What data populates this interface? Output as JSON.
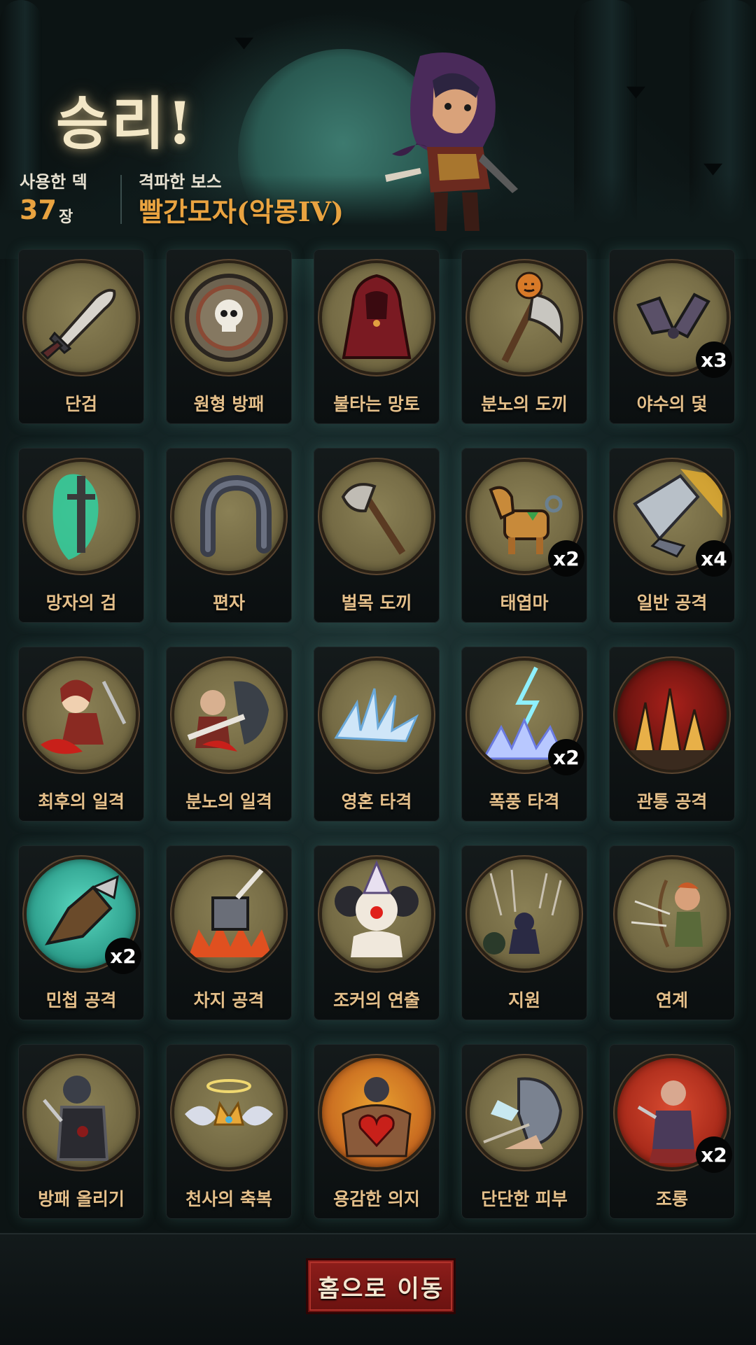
{
  "header": {
    "title": "승리!",
    "deck_label": "사용한 덱",
    "deck_count": "37",
    "deck_unit": "장",
    "boss_label": "격파한 보스",
    "boss_name": "빨간모자(악몽IV)"
  },
  "cards": [
    {
      "name": "단검",
      "icon": "dagger-icon",
      "count": ""
    },
    {
      "name": "원형 방패",
      "icon": "round-shield-icon",
      "count": ""
    },
    {
      "name": "불타는 망토",
      "icon": "red-cloak-icon",
      "count": ""
    },
    {
      "name": "분노의 도끼",
      "icon": "pumpkin-axe-icon",
      "count": ""
    },
    {
      "name": "야수의 덫",
      "icon": "beast-trap-icon",
      "count": "x3"
    },
    {
      "name": "망자의 검",
      "icon": "ghost-sword-icon",
      "count": ""
    },
    {
      "name": "편자",
      "icon": "horseshoe-icon",
      "count": ""
    },
    {
      "name": "벌목 도끼",
      "icon": "hatchet-icon",
      "count": ""
    },
    {
      "name": "태엽마",
      "icon": "wind-up-horse-icon",
      "count": "x2"
    },
    {
      "name": "일반 공격",
      "icon": "sword-strike-icon",
      "count": "x4"
    },
    {
      "name": "최후의 일격",
      "icon": "final-strike-icon",
      "count": ""
    },
    {
      "name": "분노의 일격",
      "icon": "rage-strike-icon",
      "count": ""
    },
    {
      "name": "영혼 타격",
      "icon": "ice-spikes-icon",
      "count": ""
    },
    {
      "name": "폭풍 타격",
      "icon": "lightning-icon",
      "count": "x2"
    },
    {
      "name": "관통 공격",
      "icon": "pierce-spikes-icon",
      "count": ""
    },
    {
      "name": "민첩 공격",
      "icon": "swift-slash-icon",
      "count": "x2"
    },
    {
      "name": "차지 공격",
      "icon": "hammer-slam-icon",
      "count": ""
    },
    {
      "name": "조커의 연출",
      "icon": "joker-icon",
      "count": ""
    },
    {
      "name": "지원",
      "icon": "arrow-rain-icon",
      "count": ""
    },
    {
      "name": "연계",
      "icon": "archer-icon",
      "count": ""
    },
    {
      "name": "방패 올리기",
      "icon": "tower-shield-icon",
      "count": ""
    },
    {
      "name": "천사의 축복",
      "icon": "angel-crown-icon",
      "count": ""
    },
    {
      "name": "용감한 의지",
      "icon": "brave-heart-icon",
      "count": ""
    },
    {
      "name": "단단한 피부",
      "icon": "stone-skin-icon",
      "count": ""
    },
    {
      "name": "조롱",
      "icon": "taunt-icon",
      "count": "x2"
    }
  ],
  "footer": {
    "home_button": "홈으로 이동"
  },
  "colors": {
    "accent": "#e9a340",
    "card_label": "#e4bf8a",
    "emblem_bg": "#7a6f48",
    "button": "#8e1e1b"
  }
}
